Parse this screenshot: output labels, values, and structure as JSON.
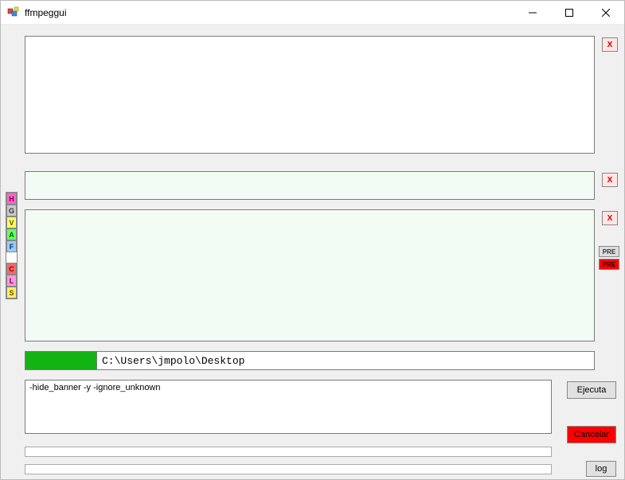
{
  "window": {
    "title": "ffmpeggui"
  },
  "side": {
    "h": "H",
    "g": "G",
    "v": "V",
    "a": "A",
    "f": "F",
    "c": "C",
    "l": "L",
    "s": "S"
  },
  "right": {
    "x1": "X",
    "x2": "X",
    "x3": "X",
    "pre1": "PRE",
    "pre2": "PRE"
  },
  "path": {
    "value": "C:\\Users\\jmpolo\\Desktop"
  },
  "cmd": {
    "value": "-hide_banner -y -ignore_unknown"
  },
  "buttons": {
    "ejecuta": "Ejecuta",
    "cancelar": "Cancelar",
    "log": "log"
  },
  "colors": {
    "sideH": "#ff66cc",
    "sideG": "#c9c9c9",
    "sideV": "#ffff66",
    "sideA": "#66ff66",
    "sideF": "#99ccff",
    "sideC": "#ff6666",
    "sideL": "#ff99dd",
    "sideS": "#ffee66"
  }
}
